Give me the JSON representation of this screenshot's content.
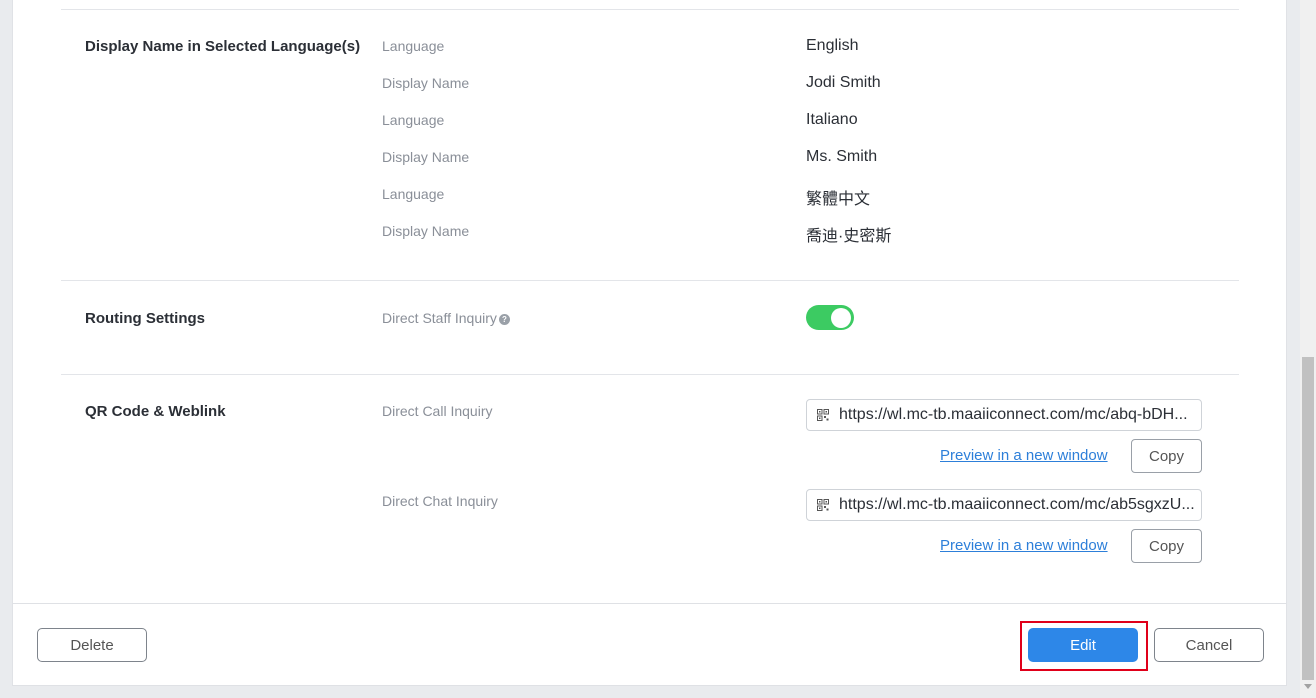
{
  "display_names": {
    "title": "Display Name in Selected Language(s)",
    "rows": [
      {
        "label": "Language",
        "value": "English"
      },
      {
        "label": "Display Name",
        "value": "Jodi Smith"
      },
      {
        "label": "Language",
        "value": "Italiano"
      },
      {
        "label": "Display Name",
        "value": "Ms. Smith"
      },
      {
        "label": "Language",
        "value": "繁體中文"
      },
      {
        "label": "Display Name",
        "value": "喬迪·史密斯"
      }
    ]
  },
  "routing": {
    "title": "Routing Settings",
    "direct_staff_label": "Direct Staff Inquiry",
    "help_glyph": "?",
    "toggle_on": true,
    "toggle_color": "#3ccb62"
  },
  "qr": {
    "title": "QR Code & Weblink",
    "call": {
      "label": "Direct Call Inquiry",
      "url": "https://wl.mc-tb.maaiiconnect.com/mc/abq-bDH...",
      "preview": "Preview in a new window",
      "copy": "Copy"
    },
    "chat": {
      "label": "Direct Chat Inquiry",
      "url": "https://wl.mc-tb.maaiiconnect.com/mc/ab5sgxzU...",
      "preview": "Preview in a new window",
      "copy": "Copy"
    }
  },
  "footer": {
    "delete": "Delete",
    "edit": "Edit",
    "cancel": "Cancel",
    "edit_color": "#2d87e8",
    "highlight_color": "#e0001a"
  },
  "icons": {
    "help": "help-circle-icon",
    "qr": "qr-code-icon"
  }
}
